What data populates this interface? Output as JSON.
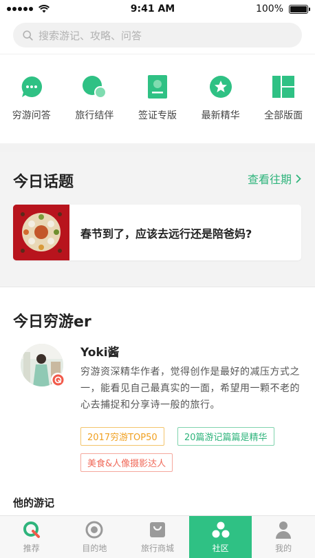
{
  "status_bar": {
    "time": "9:41 AM",
    "battery": "100%"
  },
  "search": {
    "placeholder": "搜索游记、攻略、问答"
  },
  "quick_nav": [
    {
      "label": "穷游问答",
      "icon": "chat-bubble-icon"
    },
    {
      "label": "旅行结伴",
      "icon": "companion-bubbles-icon"
    },
    {
      "label": "签证专版",
      "icon": "visa-document-icon"
    },
    {
      "label": "最新精华",
      "icon": "star-badge-icon"
    },
    {
      "label": "全部版面",
      "icon": "grid-layout-icon"
    }
  ],
  "topic_section": {
    "title": "今日话题",
    "more": "查看往期",
    "card_text": "春节到了，应该去远行还是陪爸妈?"
  },
  "person_section": {
    "title": "今日穷游er",
    "name": "Yoki酱",
    "bio": "穷游资深精华作者，觉得创作是最好的减压方式之一，能看见自己最真实的一面，希望用一颗不老的心去捕捉和分享诗一般的旅行。",
    "tags": [
      "2017穷游TOP50",
      "20篇游记篇篇是精华",
      "美食&人像摄影达人"
    ],
    "notes_heading": "他的游记"
  },
  "tab_bar": [
    {
      "label": "推荐",
      "icon": "q-logo-icon",
      "active": false
    },
    {
      "label": "目的地",
      "icon": "target-icon",
      "active": false
    },
    {
      "label": "旅行商城",
      "icon": "shopping-bag-icon",
      "active": false
    },
    {
      "label": "社区",
      "icon": "community-icon",
      "active": true
    },
    {
      "label": "我的",
      "icon": "person-icon",
      "active": false
    }
  ],
  "colors": {
    "accent": "#2fc184",
    "link": "#2fb47c",
    "topic_red": "#b8141d"
  }
}
